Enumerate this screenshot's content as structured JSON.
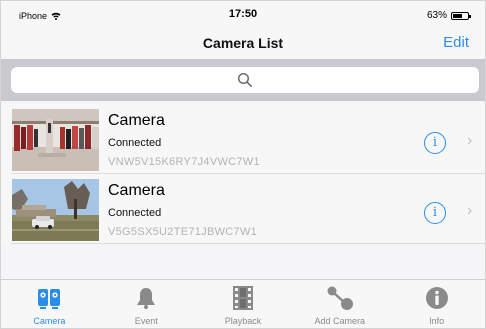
{
  "status_bar": {
    "carrier": "iPhone",
    "time": "17:50",
    "battery_percent": "63%",
    "battery_level": 0.63,
    "icons": [
      "wifi-icon",
      "battery-icon"
    ]
  },
  "nav": {
    "title": "Camera List",
    "edit_label": "Edit"
  },
  "search": {
    "placeholder": "",
    "icon": "search-icon"
  },
  "cameras": [
    {
      "name": "Camera",
      "status": "Connected",
      "id": "VNW5V15K6RY7J4VWC7W1",
      "thumbnail": "store-interior"
    },
    {
      "name": "Camera",
      "status": "Connected",
      "id": "V5G5SX5U2TE71JBWC7W1",
      "thumbnail": "yard-with-car"
    }
  ],
  "tabs": [
    {
      "label": "Camera",
      "icon": "camera-icon",
      "active": true
    },
    {
      "label": "Event",
      "icon": "bell-icon",
      "active": false
    },
    {
      "label": "Playback",
      "icon": "film-icon",
      "active": false
    },
    {
      "label": "Add Camera",
      "icon": "add-camera-icon",
      "active": false
    },
    {
      "label": "Info",
      "icon": "info-icon",
      "active": false
    }
  ],
  "colors": {
    "accent": "#2a8ee8",
    "tab_inactive": "#8a8a8a",
    "device_id": "#b3b3b3"
  }
}
